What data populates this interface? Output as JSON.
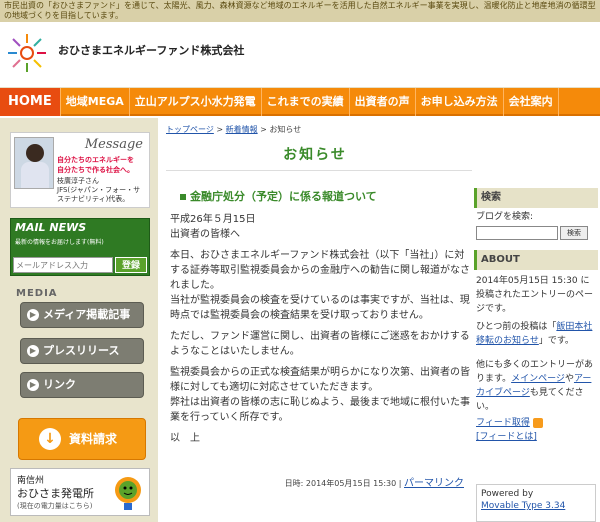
{
  "topbar": {
    "text": "市民出資の「おひさまファンド」を通じて、太陽光、風力、森林資源など地域のエネルギーを活用した自然エネルギー事業を実現し、温暖化防止と地産地消の循環型の地域づくりを目指しています。"
  },
  "header": {
    "company": "おひさまエネルギーファンド株式会社"
  },
  "nav": {
    "items": [
      {
        "label": "HOME",
        "key": "home"
      },
      {
        "label": "地域MEGA",
        "key": "mega"
      },
      {
        "label": "立山アルプス小水力発電",
        "key": "hydro"
      },
      {
        "label": "これまでの実績",
        "key": "results"
      },
      {
        "label": "出資者の声",
        "key": "voices"
      },
      {
        "label": "お申し込み方法",
        "key": "apply"
      },
      {
        "label": "会社案内",
        "key": "about"
      }
    ]
  },
  "left": {
    "message": {
      "title": "Message",
      "tag1": "自分たちのエネルギーを",
      "tag2": "自分たちで作る社会へ。",
      "name1": "枝廣淳子さん",
      "name2": "JFS(ジャパン・フォー・サ",
      "name3": "ステナビリティ)代表。"
    },
    "mail": {
      "title": "MAIL NEWS",
      "sub": "最新の情報をお届けします(無料)",
      "placeholder": "メールアドレス入力",
      "button": "登録"
    },
    "media_label": "MEDIA",
    "media_items": [
      {
        "label": "メディア掲載記事"
      },
      {
        "label": "プレスリリース"
      },
      {
        "label": "リンク"
      }
    ],
    "request_button": "資料請求",
    "plant": {
      "t1": "南信州",
      "t2": "おひさま発電所",
      "t3": "(現在の電力量はこちら)"
    }
  },
  "main": {
    "breadcrumb": [
      {
        "label": "トップページ"
      },
      {
        "label": "新着情報"
      },
      {
        "label": "お知らせ"
      }
    ],
    "crumb_sep": " > ",
    "page_title": "お知らせ",
    "entry": {
      "title": "金融庁処分（予定）に係る報道ついて",
      "date": "平成26年５月15日",
      "greeting": "出資者の皆様へ",
      "p1": "本日、おひさまエネルギーファンド株式会社（以下「当社」）に対する証券等取引監視委員会からの金融庁への勧告に関し報道がなされました。",
      "p2": "当社が監視委員会の検査を受けているのは事実ですが、当社は、現時点では監視委員会の検査結果を受け取っておりません。",
      "p3": "ただし、ファンド運営に関し、出資者の皆様にご迷惑をおかけするようなことはいたしません。",
      "p4": "監視委員会からの正式な検査結果が明らかになり次第、出資者の皆様に対しても適切に対応させていただきます。",
      "p5": "弊社は出資者の皆様の志に恥じぬよう、最後まで地域に根付いた事業を行っていく所存です。",
      "closing": "以　上",
      "footer_prefix": "日時: 2014年05月15日 15:30 | ",
      "permalink": "パーマリンク"
    }
  },
  "right": {
    "search_head": "検索",
    "search_label": "ブログを検索:",
    "search_button": "検索",
    "about_head": "ABOUT",
    "about_text": "2014年05月15日 15:30 に投稿されたエントリーのページです。",
    "prev_prefix": "ひとつ前の投稿は「",
    "prev_link": "飯田本社移転のお知らせ",
    "prev_suffix": "」です。",
    "more_prefix": "他にも多くのエントリーがあります。",
    "main_link": "メインページ",
    "or_text": "や",
    "archive_link": "アーカイブページ",
    "more_suffix": "も見てください。",
    "feed": "フィード取得",
    "feed_about": "[フィードとは]",
    "powered1": "Powered by",
    "powered2": "Movable Type 3.34"
  }
}
